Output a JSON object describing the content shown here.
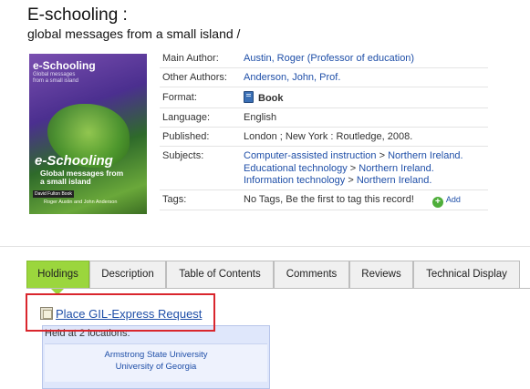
{
  "record": {
    "title": "E-schooling :",
    "subtitle": "global messages from a small island /"
  },
  "cover": {
    "title_top": "e-Schooling",
    "title_top_sub": "Global messages from a small island",
    "big_title": "e-Schooling",
    "big_sub_1": "Global messages from",
    "big_sub_2": "a small island",
    "authors": "Roger Austin and John Anderson",
    "publisher": "David Fulton Book"
  },
  "details": {
    "main_author": {
      "label": "Main Author:",
      "value": "Austin, Roger (Professor of education)"
    },
    "other_authors": {
      "label": "Other Authors:",
      "value": "Anderson, John, Prof."
    },
    "format": {
      "label": "Format:",
      "value": "Book",
      "icon": "book-icon"
    },
    "language": {
      "label": "Language:",
      "value": "English"
    },
    "published": {
      "label": "Published:",
      "value": "London ; New York : Routledge, 2008."
    },
    "subjects": {
      "label": "Subjects:",
      "items": [
        {
          "topic": "Computer-assisted instruction",
          "sep": " > ",
          "place": "Northern Ireland."
        },
        {
          "topic": "Educational technology",
          "sep": " > ",
          "place": "Northern Ireland."
        },
        {
          "topic": "Information technology",
          "sep": " > ",
          "place": "Northern Ireland."
        }
      ]
    },
    "tags": {
      "label": "Tags:",
      "value": "No Tags, Be the first to tag this record!",
      "add_label": "Add"
    }
  },
  "tabs": [
    {
      "label": "Holdings",
      "active": true
    },
    {
      "label": "Description",
      "active": false
    },
    {
      "label": "Table of Contents",
      "active": false
    },
    {
      "label": "Comments",
      "active": false
    },
    {
      "label": "Reviews",
      "active": false
    },
    {
      "label": "Technical Display",
      "active": false
    }
  ],
  "holdings": {
    "request_label": "Place GIL-Express Request",
    "held_text": "Held at 2 locations:",
    "locations": [
      "Armstrong State University",
      "University of Georgia"
    ]
  },
  "colors": {
    "link": "#1f4fa8",
    "active_tab": "#9bd63d",
    "highlight_box": "#d9262d",
    "holdings_panel": "#dfe7fb"
  }
}
